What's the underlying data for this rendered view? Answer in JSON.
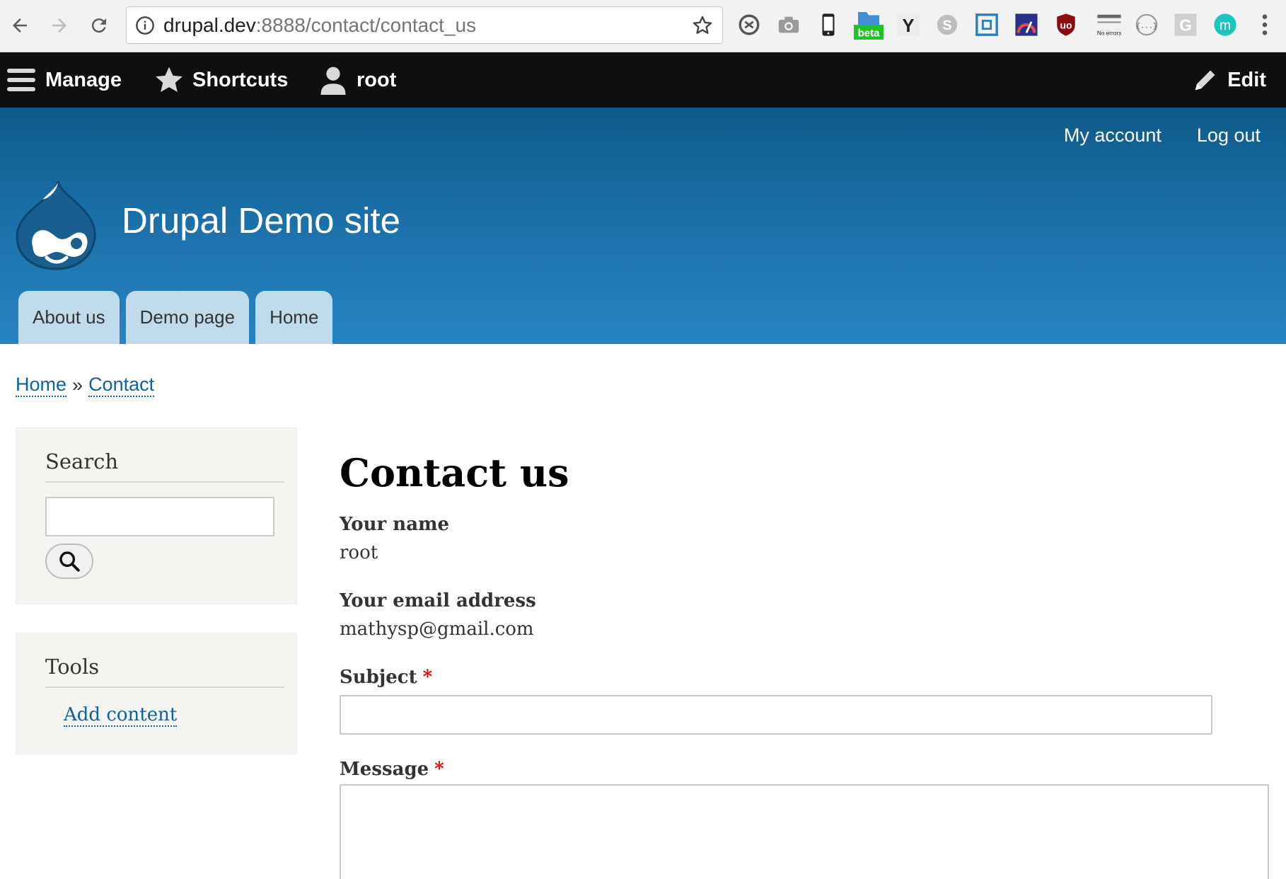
{
  "browser": {
    "url_host": "drupal.dev",
    "url_path": ":8888/contact/contact_us",
    "extensions": [
      "sync-icon",
      "camera-icon",
      "mobile-phone-icon",
      "beta-folder-icon",
      "yslow-icon",
      "skype-icon",
      "frame-icon",
      "speed-meter-icon",
      "ublock-icon",
      "no-errors-icon",
      "json-icon",
      "g-icon",
      "m-avatar-icon"
    ],
    "beta_badge": "beta",
    "no_errors_text": "No errors",
    "json_text": "{...}",
    "g_text": "G",
    "m_text": "m",
    "y_text": "Y"
  },
  "toolbar": {
    "manage": "Manage",
    "shortcuts": "Shortcuts",
    "user": "root",
    "edit": "Edit"
  },
  "header": {
    "account_menu": [
      "My account",
      "Log out"
    ],
    "site_name": "Drupal Demo site",
    "main_menu": [
      "About us",
      "Demo page",
      "Home"
    ]
  },
  "breadcrumb": {
    "items": [
      "Home",
      "Contact"
    ],
    "separator": "»"
  },
  "sidebar": {
    "search_title": "Search",
    "tools_title": "Tools",
    "tools_link": "Add content"
  },
  "form": {
    "title": "Contact us",
    "name_label": "Your name",
    "name_value": "root",
    "email_label": "Your email address",
    "email_value": "mathysp@gmail.com",
    "subject_label": "Subject",
    "message_label": "Message",
    "required_marker": "*"
  },
  "colors": {
    "toolbar_bg": "#0f0f0f",
    "header_top": "#0e5a8a",
    "header_bottom": "#2784c2",
    "tab_bg": "#c0dbec",
    "link": "#0b62a5",
    "required": "#e00000"
  }
}
